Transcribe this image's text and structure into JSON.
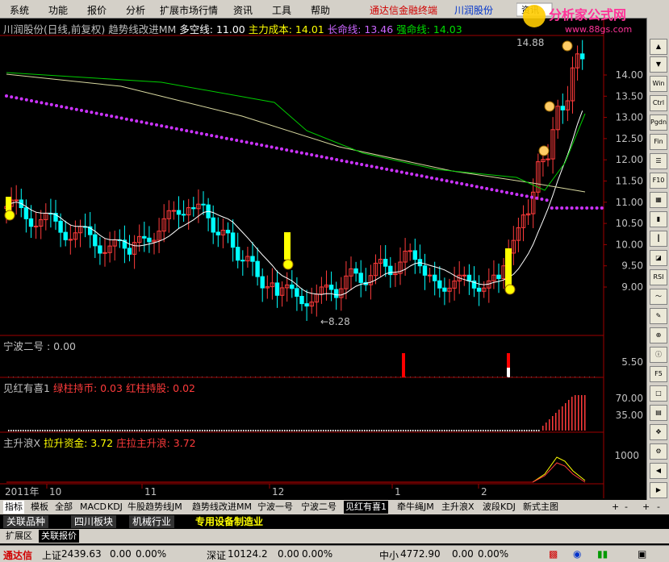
{
  "menu": {
    "items": [
      "系统",
      "功能",
      "报价",
      "分析",
      "扩展市场行情",
      "资讯",
      "工具",
      "帮助"
    ],
    "brand": "通达信金融终端",
    "stock_name": "川润股份",
    "logo_text": "分析家公式网",
    "logo_url": "www.88gs.com",
    "logo_tag": "资讯"
  },
  "main_header": {
    "title": "川润股份(日线,前复权)",
    "indicator": "趋势线改进MM",
    "duo_kong": "多空线: 11.00",
    "zhuli": "主力成本: 14.01",
    "changming": "长命线: 13.46",
    "qiangming": "强命线: 14.03"
  },
  "sub1_header": {
    "name": "宁波二号 : 0.00"
  },
  "sub2_header": {
    "name": "见红有喜1",
    "green": "绿柱持币: 0.03",
    "red": "红柱持股: 0.02"
  },
  "sub3_header": {
    "name": "主升浪X",
    "lasheng": "拉升资金: 3.72",
    "zhuang": "庄拉主升浪: 3.72"
  },
  "annotations": {
    "high": "14.88",
    "low": "←8.28"
  },
  "yaxis_main": [
    "14.00",
    "13.50",
    "13.00",
    "12.50",
    "12.00",
    "11.50",
    "11.00",
    "10.50",
    "10.00",
    "9.50",
    "9.00"
  ],
  "yaxis_sub1": [
    "5.50"
  ],
  "yaxis_sub2": [
    "70.00",
    "35.00"
  ],
  "yaxis_sub3": [
    "1000"
  ],
  "xaxis": {
    "year": "2011年",
    "months": [
      "10",
      "11",
      "12",
      "1",
      "2"
    ],
    "period": "日线"
  },
  "tabs": [
    "指标",
    "模板",
    "全部",
    "MACD",
    "KDJ",
    "牛股趋势线JM",
    "趋势线改进MM",
    "宁波一号",
    "宁波二号",
    "见红有喜1",
    "牵牛绳JM",
    "主升浪X",
    "波段KDJ",
    "新式主图"
  ],
  "tab_controls": [
    "+",
    "-",
    "+",
    "-"
  ],
  "sections": [
    "关联品种",
    "四川板块",
    "机械行业",
    "专用设备制造业"
  ],
  "ext": [
    "扩展区",
    "关联报价"
  ],
  "status": {
    "app": "通达信",
    "sh_label": "上证",
    "sh_value": "2439.63",
    "sh_change": "0.00",
    "sh_pct": "0.00%",
    "sz_label": "深证",
    "sz_value": "10124.2",
    "sz_change": "0.00",
    "sz_pct": "0.00%",
    "zx_label": "中小",
    "zx_value": "4772.90",
    "zx_change": "0.00",
    "zx_pct": "0.00%"
  },
  "right_toolbar": [
    "Win",
    "Ctrl",
    "Pgdn",
    "Fin",
    "F10",
    "RSI",
    "F5"
  ],
  "colors": {
    "up": "#ff3b3b",
    "down": "#00ffff",
    "ma": "#ffffff",
    "purple": "#cc33ff",
    "green": "#00cc00",
    "khaki": "#d8d8a0",
    "yellow": "#ffff00"
  }
}
